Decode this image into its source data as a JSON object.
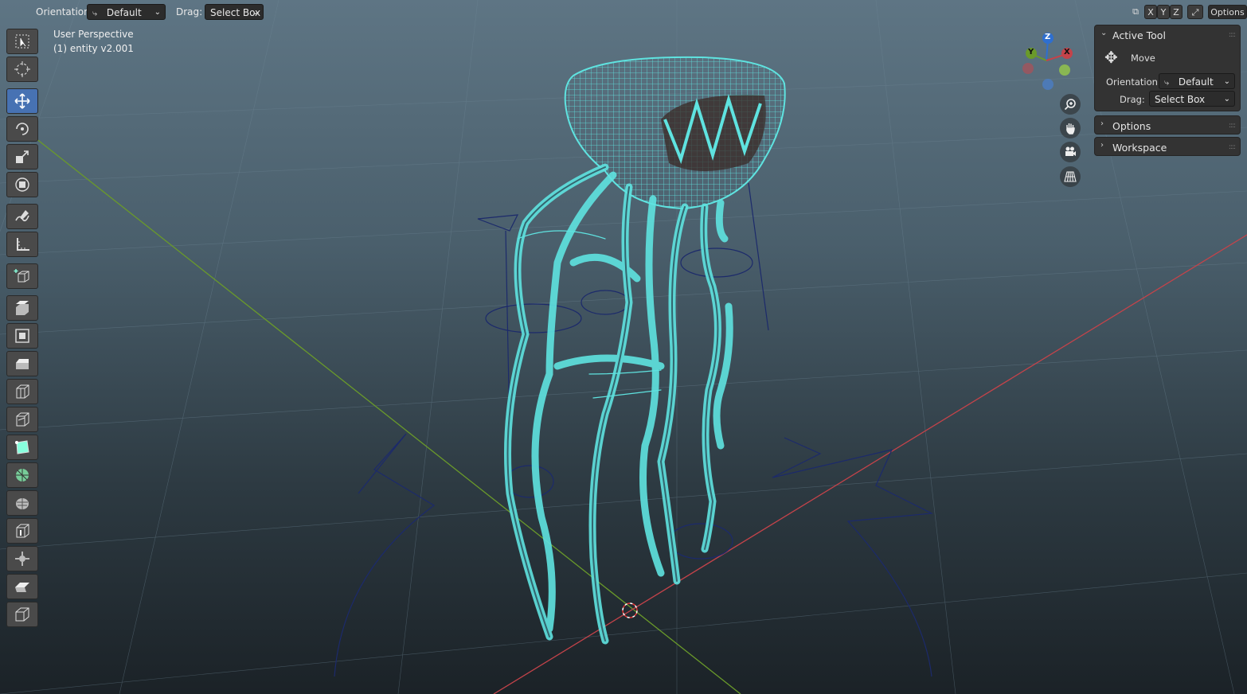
{
  "header": {
    "orientation_label": "Orientation:",
    "orientation_value": "Default",
    "drag_label": "Drag:",
    "drag_value": "Select Box",
    "axis_x": "X",
    "axis_y": "Y",
    "axis_z": "Z",
    "options_label": "Options"
  },
  "viewport": {
    "view_name": "User Perspective",
    "object_info": "(1) entity v2.001"
  },
  "gizmo": {
    "z": "Z",
    "y": "Y",
    "x": "X"
  },
  "toolbar": {
    "tools": [
      "select-box",
      "cursor",
      "move",
      "rotate",
      "scale",
      "transform",
      "annotate",
      "measure",
      "add-cube",
      "extrude-region",
      "inset-faces",
      "bevel",
      "loop-cut",
      "knife",
      "poly-build",
      "spin",
      "smooth",
      "edge-slide",
      "shrink-fatten",
      "shear",
      "rip-region"
    ],
    "active_tool": "move"
  },
  "sidebar": {
    "active_tool_title": "Active Tool",
    "tool_name": "Move",
    "orientation_label": "Orientation",
    "orientation_value": "Default",
    "drag_label": "Drag:",
    "drag_value": "Select Box",
    "options_title": "Options",
    "workspace_title": "Workspace"
  },
  "colors": {
    "wireframe": "#5fe3e0",
    "active_tool": "#4772b3",
    "x_axis": "#c4434a",
    "y_axis": "#6a9a2a",
    "z_axis": "#2e6fd0"
  }
}
